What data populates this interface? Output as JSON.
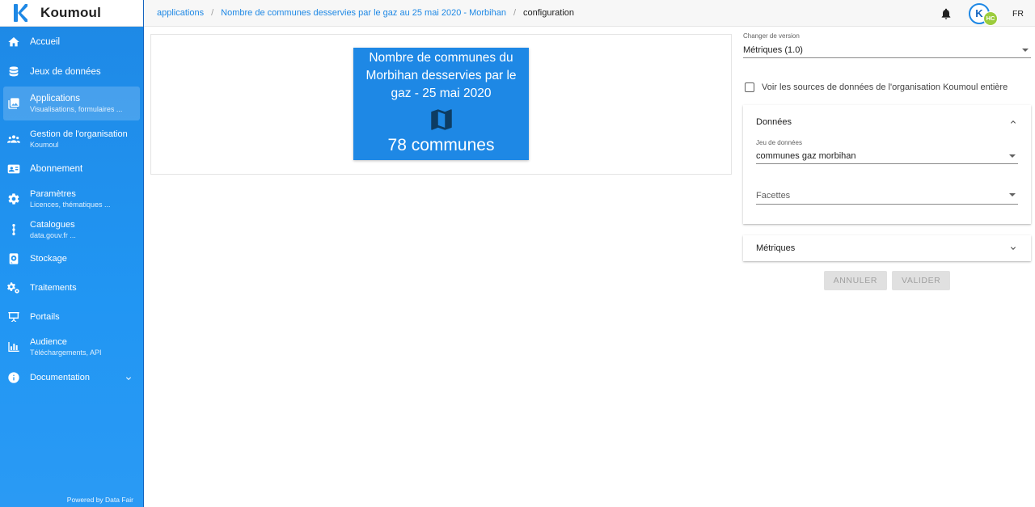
{
  "app": {
    "name": "Koumoul"
  },
  "sidebar": {
    "items": [
      {
        "label": "Accueil",
        "sub": ""
      },
      {
        "label": "Jeux de données",
        "sub": ""
      },
      {
        "label": "Applications",
        "sub": "Visualisations, formulaires ..."
      },
      {
        "label": "Gestion de l'organisation",
        "sub": "Koumoul"
      },
      {
        "label": "Abonnement",
        "sub": ""
      },
      {
        "label": "Paramètres",
        "sub": "Licences, thématiques ..."
      },
      {
        "label": "Catalogues",
        "sub": "data.gouv.fr ..."
      },
      {
        "label": "Stockage",
        "sub": ""
      },
      {
        "label": "Traitements",
        "sub": ""
      },
      {
        "label": "Portails",
        "sub": ""
      },
      {
        "label": "Audience",
        "sub": "Téléchargements, API"
      },
      {
        "label": "Documentation",
        "sub": ""
      }
    ],
    "powered": "Powered by Data Fair"
  },
  "breadcrumb": {
    "items": [
      "applications",
      "Nombre de communes desservies par le gaz au 25 mai 2020 - Morbihan",
      "configuration"
    ]
  },
  "header": {
    "avatar_badge": "HC",
    "lang": "FR"
  },
  "preview": {
    "title": "Nombre de communes du Morbihan desservies par le gaz - 25 mai 2020",
    "value": "78 communes",
    "accent": "#1e88e5"
  },
  "config": {
    "version_label": "Changer de version",
    "version_value": "Métriques (1.0)",
    "checkbox_label": "Voir les sources de données de l'organisation Koumoul entière",
    "data_section": {
      "title": "Données",
      "dataset_label": "Jeu de données",
      "dataset_value": "communes gaz morbihan",
      "facets_placeholder": "Facettes"
    },
    "metrics_section": {
      "title": "Métriques"
    },
    "cancel_label": "ANNULER",
    "submit_label": "VALIDER"
  }
}
